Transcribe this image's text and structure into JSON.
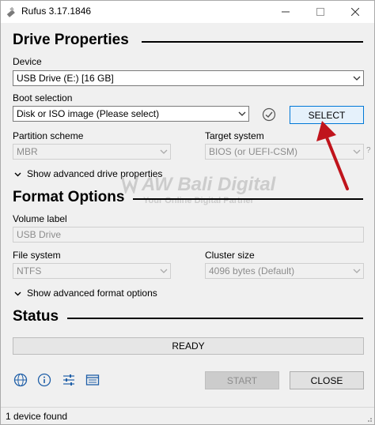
{
  "window": {
    "title": "Rufus 3.17.1846"
  },
  "drive_properties": {
    "heading": "Drive Properties",
    "device_label": "Device",
    "device_value": "USB Drive (E:) [16 GB]",
    "boot_selection_label": "Boot selection",
    "boot_selection_value": "Disk or ISO image (Please select)",
    "select_button": "SELECT",
    "partition_scheme_label": "Partition scheme",
    "partition_scheme_value": "MBR",
    "target_system_label": "Target system",
    "target_system_value": "BIOS (or UEFI-CSM)",
    "target_help": "?",
    "advanced_toggle": "Show advanced drive properties"
  },
  "format_options": {
    "heading": "Format Options",
    "volume_label_label": "Volume label",
    "volume_label_value": "USB Drive",
    "file_system_label": "File system",
    "file_system_value": "NTFS",
    "cluster_size_label": "Cluster size",
    "cluster_size_value": "4096 bytes (Default)",
    "advanced_toggle": "Show advanced format options"
  },
  "status": {
    "heading": "Status",
    "progress_text": "READY",
    "start_button": "START",
    "close_button": "CLOSE",
    "status_bar": "1 device found"
  },
  "toolbar_icons": [
    "globe-icon",
    "info-icon",
    "settings-sliders-icon",
    "log-icon"
  ],
  "watermark": {
    "title": "AW Bali Digital",
    "subtitle": "Your Online Digital Partner"
  },
  "colors": {
    "select_button_bg": "#e5f1fb",
    "select_button_border": "#0078d7",
    "annotation_arrow": "#c0141c"
  }
}
